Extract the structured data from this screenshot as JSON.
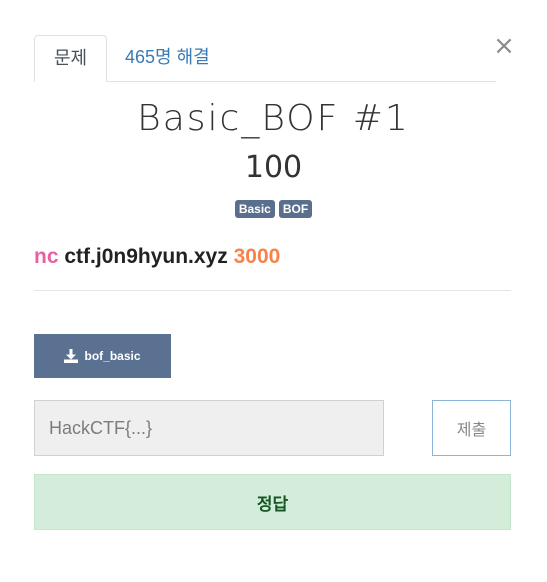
{
  "tabs": [
    {
      "label": "문제",
      "active": true
    },
    {
      "label": "465명 해결",
      "active": false
    }
  ],
  "close_label": "×",
  "challenge": {
    "title": "Basic_BOF #1",
    "points": "100",
    "tags": [
      "Basic",
      "BOF"
    ],
    "connection": {
      "cmd": "nc",
      "host": "ctf.j0n9hyun.xyz",
      "port": "3000"
    }
  },
  "download": {
    "icon": "download-icon",
    "label": "bof_basic"
  },
  "flag_form": {
    "placeholder": "HackCTF{...}",
    "value": "",
    "submit_label": "제출"
  },
  "result": {
    "label": "정답",
    "status": "success"
  },
  "colors": {
    "nc": "#e85fa2",
    "port": "#f7834b",
    "tag_bg": "#5a6f8e",
    "download_bg": "#5a7191",
    "tab_link": "#3a7ab5",
    "success_bg": "#d4edda",
    "success_text": "#155724"
  }
}
